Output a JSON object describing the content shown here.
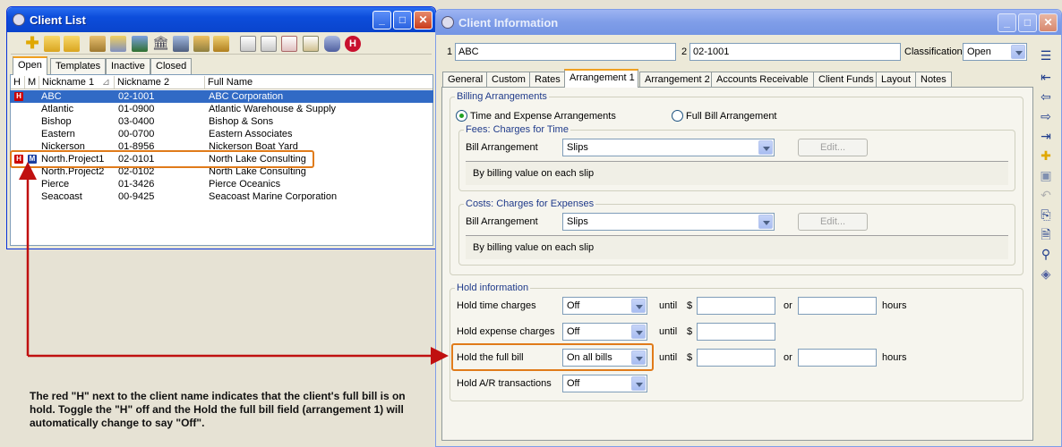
{
  "client_list": {
    "title": "Client List",
    "tabs": [
      "Open",
      "Templates",
      "Inactive",
      "Closed"
    ],
    "columns": {
      "h": "H",
      "m": "M",
      "nickname1": "Nickname 1",
      "nickname2": "Nickname 2",
      "fullname": "Full Name"
    },
    "rows": [
      {
        "h": "H",
        "nickname1": "ABC",
        "nickname2": "02-1001",
        "fullname": "ABC Corporation"
      },
      {
        "nickname1": "Atlantic",
        "nickname2": "01-0900",
        "fullname": "Atlantic Warehouse & Supply"
      },
      {
        "nickname1": "Bishop",
        "nickname2": "03-0400",
        "fullname": "Bishop & Sons"
      },
      {
        "nickname1": "Eastern",
        "nickname2": "00-0700",
        "fullname": "Eastern Associates"
      },
      {
        "nickname1": "Nickerson",
        "nickname2": "01-8956",
        "fullname": "Nickerson Boat Yard"
      },
      {
        "h": "H",
        "m": "M",
        "nickname1": "North.Project1",
        "nickname2": "02-0101",
        "fullname": "North Lake Consulting"
      },
      {
        "nickname1": "North.Project2",
        "nickname2": "02-0102",
        "fullname": "North Lake Consulting"
      },
      {
        "nickname1": "Pierce",
        "nickname2": "01-3426",
        "fullname": "Pierce Oceanics"
      },
      {
        "nickname1": "Seacoast",
        "nickname2": "00-9425",
        "fullname": "Seacoast Marine Corporation"
      }
    ]
  },
  "client_info": {
    "title": "Client Information",
    "field1_num": "1",
    "field1_value": "ABC",
    "field2_num": "2",
    "field2_value": "02-1001",
    "classification_label": "Classification",
    "classification_value": "Open",
    "tabs": [
      "General",
      "Custom",
      "Rates",
      "Arrangement 1",
      "Arrangement 2",
      "Accounts Receivable",
      "Client Funds",
      "Layout",
      "Notes"
    ],
    "billing": {
      "group_label": "Billing Arrangements",
      "radio_time": "Time and Expense Arrangements",
      "radio_full": "Full Bill Arrangement",
      "fees_label": "Fees: Charges for Time",
      "fees_bill_label": "Bill Arrangement",
      "fees_bill_value": "Slips",
      "fees_edit": "Edit...",
      "fees_desc": "By billing value on each slip",
      "costs_label": "Costs: Charges for Expenses",
      "costs_bill_label": "Bill Arrangement",
      "costs_bill_value": "Slips",
      "costs_edit": "Edit...",
      "costs_desc": "By billing value on each slip"
    },
    "hold": {
      "group_label": "Hold information",
      "time_label": "Hold time charges",
      "time_value": "Off",
      "expense_label": "Hold expense charges",
      "expense_value": "Off",
      "full_label": "Hold the full bill",
      "full_value": "On all bills",
      "ar_label": "Hold A/R transactions",
      "ar_value": "Off",
      "until": "until",
      "dollar": "$",
      "or": "or",
      "hours": "hours"
    }
  },
  "annotation": "The red \"H\" next to the client name indicates that the client's full bill is on hold.  Toggle the \"H\" off and the Hold the full bill field (arrangement 1) will automatically change to say \"Off\".",
  "colors": {
    "highlight_orange": "#e07b1a",
    "arrow_red": "#c01010",
    "selection_blue": "#316ac5"
  }
}
